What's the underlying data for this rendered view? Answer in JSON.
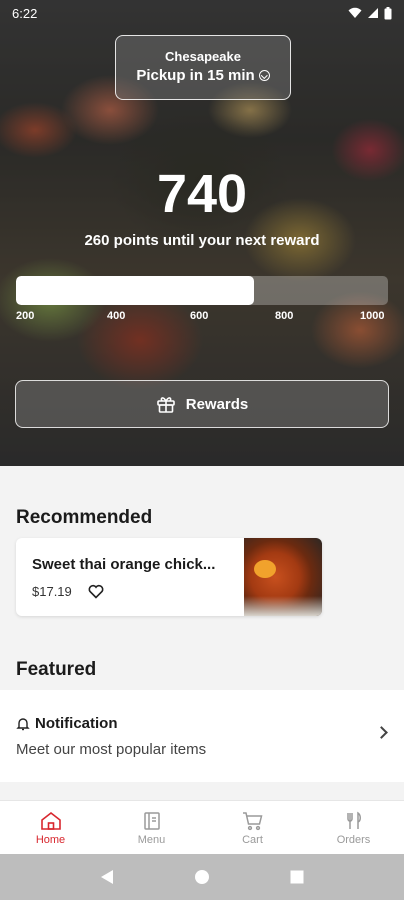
{
  "status_bar": {
    "time": "6:22",
    "icons": [
      "wifi-icon",
      "signal-icon",
      "battery-icon"
    ]
  },
  "location": {
    "name": "Chesapeake",
    "pickup": "Pickup in 15 min"
  },
  "rewards": {
    "points": "740",
    "message": "260 points until your next reward",
    "progress_fraction": 0.64,
    "ticks": [
      "200",
      "400",
      "600",
      "800",
      "1000"
    ],
    "button_label": "Rewards"
  },
  "recommended": {
    "title": "Recommended",
    "item": {
      "name": "Sweet thai orange chick...",
      "price": "$17.19"
    }
  },
  "featured": {
    "title": "Featured",
    "notification": {
      "title": "Notification",
      "subtitle": "Meet our most popular items"
    }
  },
  "bottom_nav": [
    {
      "label": "Home",
      "icon": "home-icon",
      "active": true
    },
    {
      "label": "Menu",
      "icon": "menu-icon",
      "active": false
    },
    {
      "label": "Cart",
      "icon": "cart-icon",
      "active": false
    },
    {
      "label": "Orders",
      "icon": "orders-icon",
      "active": false
    }
  ],
  "colors": {
    "accent": "#d8272e",
    "nav_inactive": "#9a9a9a",
    "card_bg": "#ffffff"
  }
}
